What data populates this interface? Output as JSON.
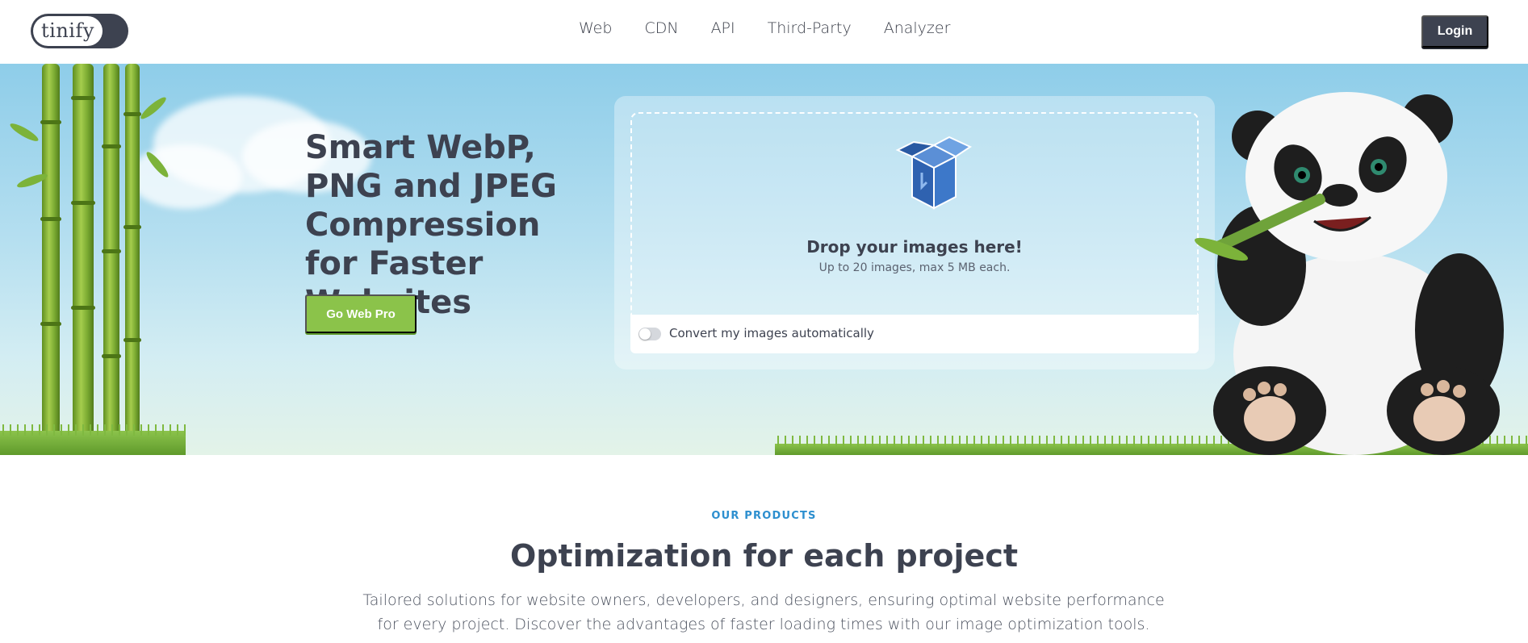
{
  "header": {
    "logo_text": "tinify",
    "nav": [
      {
        "label": "Web"
      },
      {
        "label": "CDN"
      },
      {
        "label": "API"
      },
      {
        "label": "Third-Party"
      },
      {
        "label": "Analyzer"
      }
    ],
    "login_label": "Login"
  },
  "hero": {
    "title": "Smart WebP, PNG and JPEG Compression for Faster Websites",
    "cta_label": "Go Web Pro",
    "dropzone": {
      "title": "Drop your images here!",
      "subtitle": "Up to 20 images, max 5 MB each.",
      "toggle_label": "Convert my images automatically",
      "toggle_on": false
    }
  },
  "products": {
    "eyebrow": "OUR PRODUCTS",
    "title": "Optimization for each project",
    "description": "Tailored solutions for website owners, developers, and designers, ensuring optimal website performance for every project. Discover the advantages of faster loading times with our image optimization tools."
  },
  "colors": {
    "brand_dark": "#3d4250",
    "cta_green": "#8bc34a",
    "eyebrow_blue": "#2d8fcf",
    "sky": "#8ecde9"
  },
  "icons": [
    "logo-toggle-icon",
    "box-icon",
    "toggle-switch",
    "panda-mascot",
    "bamboo-illustration"
  ]
}
